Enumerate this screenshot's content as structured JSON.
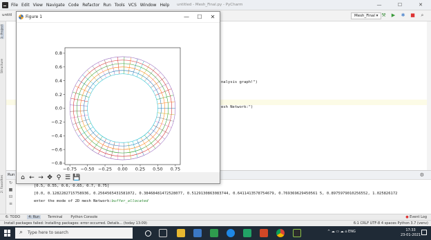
{
  "ide": {
    "menu": [
      "File",
      "Edit",
      "View",
      "Navigate",
      "Code",
      "Refactor",
      "Run",
      "Tools",
      "VCS",
      "Window",
      "Help"
    ],
    "window_title": "untitled - Mesh_Final.py - PyCharm",
    "project_crumb": "untitl",
    "run_config": "Mesh_Final",
    "left_tabs": [
      "1: Project",
      "Structure",
      "2: Favorites"
    ],
    "code_lines": [
      {
        "text": "nalysis graph!\")"
      },
      {
        "text": "esh Network:\")"
      }
    ]
  },
  "run_panel": {
    "tab_label": "Run",
    "console": {
      "line1": "[0.5, 0.55, 0.6, 0.65, 0.7, 0.75]",
      "line2": "[0.0, 0.1282282715758936, 0.2564565431581072, 0.38468481472528077, 0.5129130863083744, 0.6411413578754679, 0.769369629450561 5, 0.8975979010256552, 1.025826172",
      "line3_prefix": "enter the mode of 2D mesh Network:",
      "line3_input": "buffer_allocated"
    }
  },
  "bottom_tabs": [
    "6: TODO",
    "4: Run",
    "Terminal",
    "Python Console"
  ],
  "event_log": "Event Log",
  "status": {
    "message": "Install packages failed: Installing packages: error occurred. Details... (today 13:09)",
    "right": "6:1  CRLF  UTF-8  4 spaces  Python 3.7 (venv)"
  },
  "taskbar": {
    "search_placeholder": "Type here to search",
    "tray": "ENG",
    "time": "17:33",
    "date": "23-01-2021"
  },
  "figure": {
    "title": "Figure 1",
    "controls": [
      "—",
      "☐",
      "✕"
    ],
    "toolbar": [
      "home-icon",
      "back-icon",
      "forward-icon",
      "pan-icon",
      "zoom-icon",
      "configure-icon",
      "save-icon"
    ]
  },
  "chart_data": {
    "type": "line",
    "title": "",
    "xlabel": "",
    "ylabel": "",
    "xlim": [
      -0.82,
      0.82
    ],
    "ylim": [
      -0.82,
      0.88
    ],
    "xticks": [
      "−0.75",
      "−0.50",
      "−0.25",
      "0.00",
      "0.25",
      "0.50",
      "0.75"
    ],
    "xtick_values": [
      -0.75,
      -0.5,
      -0.25,
      0.0,
      0.25,
      0.5,
      0.75
    ],
    "yticks": [
      "−0.8",
      "−0.6",
      "−0.4",
      "−0.2",
      "0.0",
      "0.2",
      "0.4",
      "0.6",
      "0.8"
    ],
    "ytick_values": [
      -0.8,
      -0.6,
      -0.4,
      -0.2,
      0.0,
      0.2,
      0.4,
      0.6,
      0.8
    ],
    "radii": [
      0.5,
      0.55,
      0.6,
      0.65,
      0.7,
      0.75
    ],
    "angular_step": 0.1282282715758936,
    "n_spokes": 49,
    "colors": [
      "#1f77b4",
      "#ff7f0e",
      "#2ca02c",
      "#d62728",
      "#9467bd",
      "#8c564b",
      "#e377c2",
      "#7f7f7f",
      "#bcbd22",
      "#17becf"
    ],
    "grid": false
  }
}
